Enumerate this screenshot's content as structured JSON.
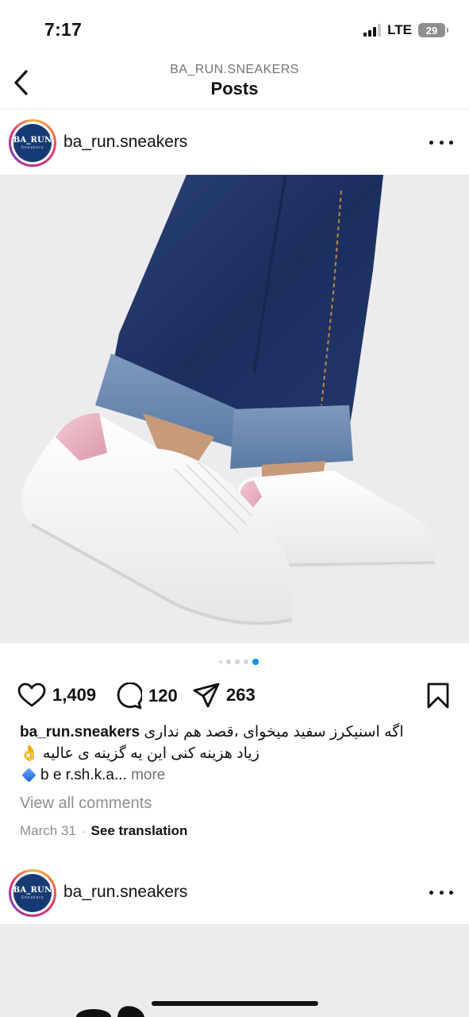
{
  "status_bar": {
    "time": "7:17",
    "network": "LTE",
    "battery": "29"
  },
  "header": {
    "subtitle": "BA_RUN.SNEAKERS",
    "title": "Posts"
  },
  "posts": [
    {
      "avatar_text": "BA_RUN",
      "avatar_subtext": "Sneakers",
      "username": "ba_run.sneakers",
      "carousel": {
        "total": 5,
        "active_index": 4
      },
      "likes": "1,409",
      "comments": "120",
      "shares": "263",
      "caption": {
        "username": "ba_run.sneakers",
        "line1": "اگه اسنیکرز سفید میخوای ،قصد هم نداری",
        "line2": "زیاد هزینه کنی این یه گزینه  ی عالیه",
        "line2_emoji": "👌",
        "line3": "b e r.sh.k.a...",
        "more": "more"
      },
      "view_comments": "View all comments",
      "date": "March 31",
      "separator": "·",
      "translate": "See translation"
    },
    {
      "avatar_text": "BA_RUN",
      "avatar_subtext": "Sneakers",
      "username": "ba_run.sneakers"
    }
  ],
  "colors": {
    "accent": "#0095f6",
    "muted": "#8e8e8e",
    "image_bg": "#ececee",
    "denim": "#1e3566"
  },
  "icons": [
    "back-chevron-icon",
    "more-dots-icon",
    "heart-icon",
    "comment-icon",
    "share-icon",
    "bookmark-icon",
    "blue-diamond-icon"
  ]
}
